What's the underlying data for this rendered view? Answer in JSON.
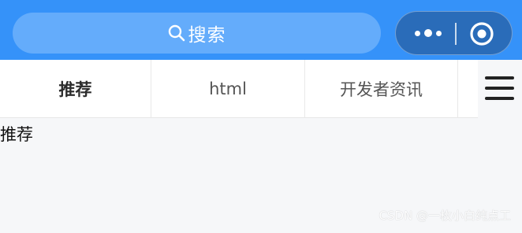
{
  "search": {
    "label": "搜索",
    "icon": "search-icon"
  },
  "capsule": {
    "more_icon": "more-dots-icon",
    "close_icon": "target-icon"
  },
  "tabs": [
    {
      "label": "推荐",
      "active": true
    },
    {
      "label": "html",
      "active": false
    },
    {
      "label": "开发者资讯",
      "active": false
    },
    {
      "label": "",
      "active": false
    }
  ],
  "menu": {
    "icon": "hamburger-menu-icon"
  },
  "content": {
    "title": "推荐"
  },
  "watermark": "CSDN @一枚小白纯点工",
  "colors": {
    "topbar": "#3592f9",
    "search_pill": "#64acfb",
    "capsule": "#2a6cb9",
    "page_bg": "#f6f7f9"
  }
}
